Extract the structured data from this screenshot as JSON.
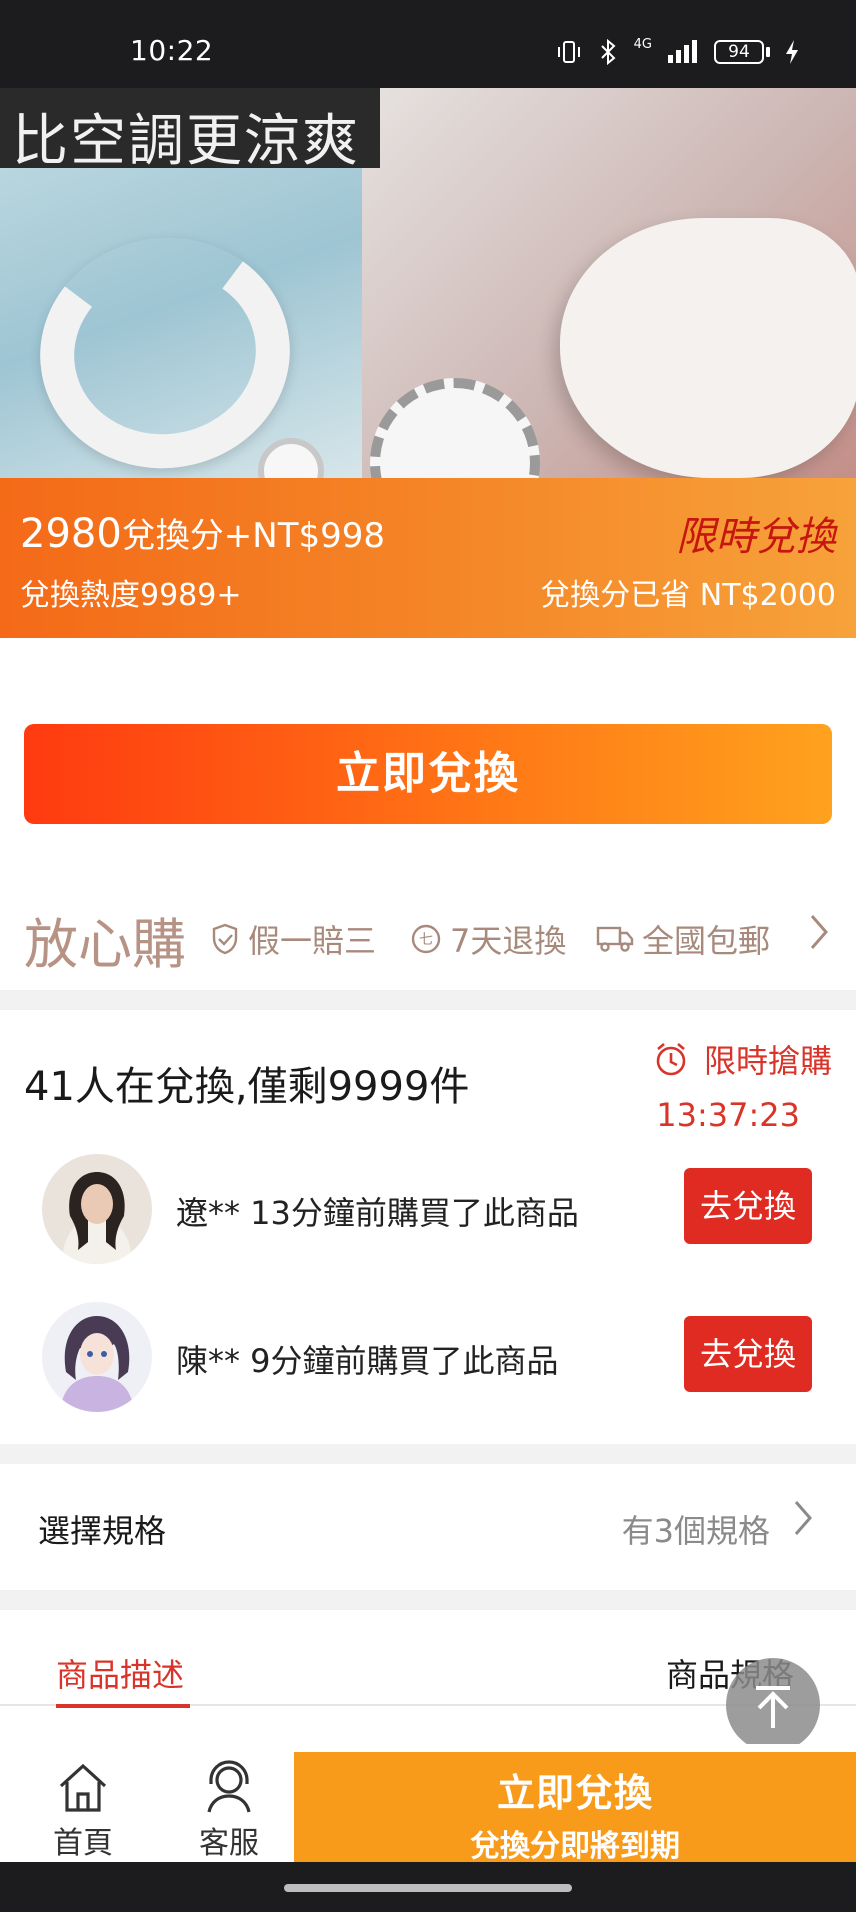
{
  "status_bar": {
    "time": "10:22",
    "battery": "94",
    "network": "4G"
  },
  "hero": {
    "title": "比空調更涼爽",
    "carousel_total": 3,
    "carousel_active": 2
  },
  "price_banner": {
    "points": "2980",
    "price_suffix": "兌換分+NT$998",
    "heat": "兌換熱度9989+",
    "limited_label": "限時兌換",
    "saved": "兌換分已省 NT$2000"
  },
  "redeem_button": "立即兌換",
  "assurance": {
    "heading": "放心購",
    "items": [
      {
        "icon": "shield-check-icon",
        "label": "假一賠三"
      },
      {
        "icon": "seven-days-icon",
        "label": "7天退換"
      },
      {
        "icon": "truck-icon",
        "label": "全國包郵"
      }
    ]
  },
  "social_proof": {
    "title": "41人在兌換,僅剩9999件",
    "flash_label": "限時搶購",
    "countdown": "13:37:23",
    "buyers": [
      {
        "text": "遼** 13分鐘前購買了此商品",
        "button": "去兌換",
        "avatar": "girl-photo"
      },
      {
        "text": "陳** 9分鐘前購買了此商品",
        "button": "去兌換",
        "avatar": "anime-girl"
      }
    ]
  },
  "spec": {
    "label": "選擇規格",
    "value": "有3個規格"
  },
  "tabs": {
    "description": "商品描述",
    "specifications": "商品規格"
  },
  "bottom_nav": {
    "home": "首頁",
    "service": "客服",
    "cta_line1": "立即兌換",
    "cta_line2": "兌換分即將到期"
  },
  "colors": {
    "accent_red": "#e02b22",
    "accent_orange": "#f89a1a",
    "assurance_brown": "#b69384"
  }
}
